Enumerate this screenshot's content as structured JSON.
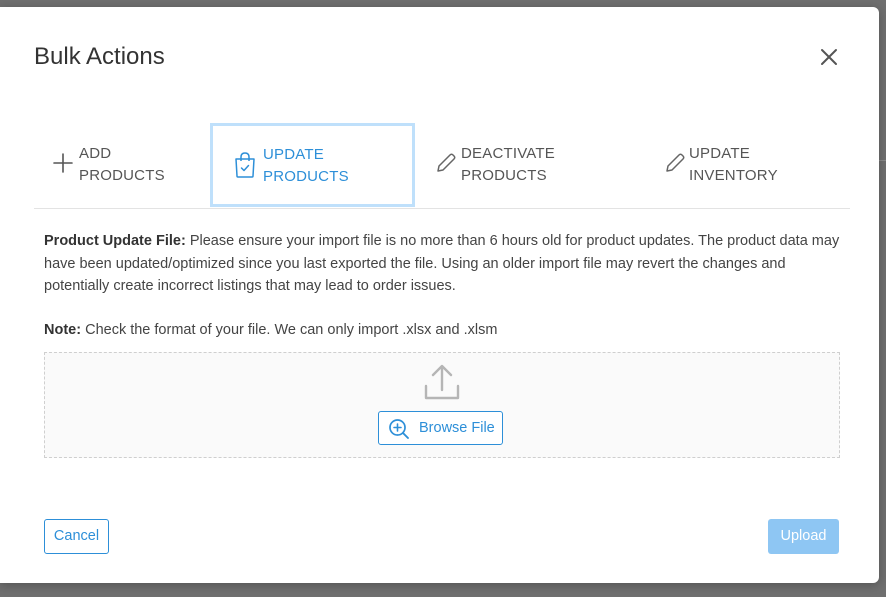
{
  "modal": {
    "title": "Bulk Actions",
    "close_icon": "close-icon"
  },
  "tabs": [
    {
      "line1": "ADD",
      "line2": "PRODUCTS",
      "icon": "plus-icon",
      "active": false
    },
    {
      "line1": "UPDATE",
      "line2": "PRODUCTS",
      "icon": "shopping-bag-check-icon",
      "active": true
    },
    {
      "line1": "DEACTIVATE",
      "line2": "PRODUCTS",
      "icon": "pencil-icon",
      "active": false
    },
    {
      "line1": "UPDATE",
      "line2": "INVENTORY",
      "icon": "pencil-icon",
      "active": false
    }
  ],
  "content": {
    "update_label": "Product Update File:",
    "update_text": " Please ensure your import file is no more than 6 hours old for product updates. The product data may have been updated/optimized since you last exported the file. Using an older import file may revert the changes and potentially create incorrect listings that may lead to order issues.",
    "note_label": "Note:",
    "note_text": " Check the format of your file. We can only import .xlsx and .xlsm"
  },
  "dropzone": {
    "upload_icon": "upload-icon",
    "browse_label": "Browse File",
    "browse_icon": "zoom-in-icon"
  },
  "footer": {
    "cancel_label": "Cancel",
    "upload_label": "Upload"
  },
  "colors": {
    "accent": "#2d8fd8",
    "active_tab_border": "#bfe0fb",
    "upload_disabled": "#8ec6f3"
  }
}
